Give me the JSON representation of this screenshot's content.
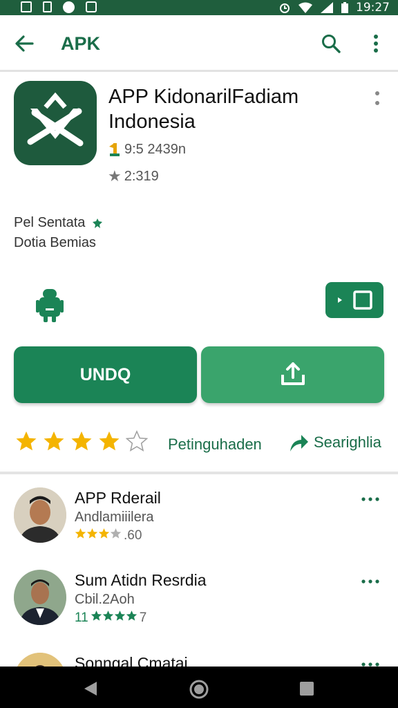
{
  "status_bar": {
    "time": "19:27"
  },
  "app_bar": {
    "title": "APK"
  },
  "app": {
    "title_line1": "APP KidonarilFadiam",
    "title_line2": "Indonesia",
    "downloads": "9:5 2439n",
    "rating": "2:319",
    "desc_line1": "Pel Sentata",
    "desc_line2": "Dotia Bemias"
  },
  "actions": {
    "primary_label": "UNDQ",
    "rating_link": "Petinguhaden",
    "share_link": "Searighlia"
  },
  "rating": {
    "stars_filled": 4,
    "stars_total": 5
  },
  "colors": {
    "brand": "#1b8456",
    "brand_dark": "#1f5e3d",
    "star": "#f4b400",
    "text_green": "#1a6d49"
  },
  "reviews": [
    {
      "name": "APP Rderail",
      "sub": "Andlamiiilera",
      "meta": ".60",
      "stars": 2.5
    },
    {
      "name": "Sum Atidn Resrdia",
      "sub": "Cbil.2Aoh",
      "meta": "7",
      "prefix": "11",
      "stars": 3.5
    },
    {
      "name": "Sonngal Cmatai",
      "sub": "",
      "meta": "",
      "stars": 0
    }
  ]
}
